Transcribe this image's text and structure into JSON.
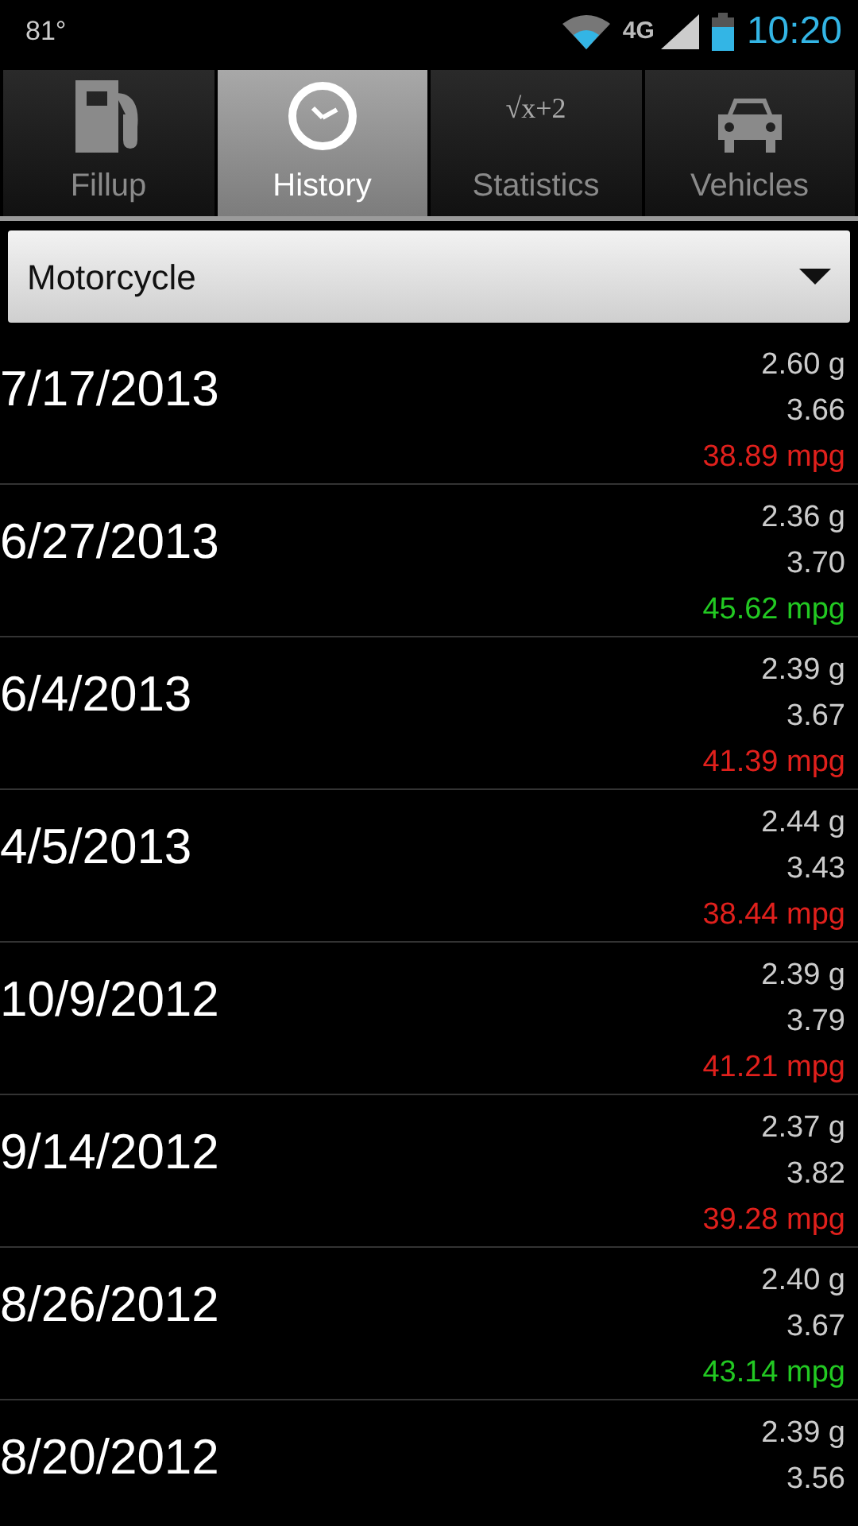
{
  "status_bar": {
    "temperature": "81°",
    "network": "4G",
    "time": "10:20"
  },
  "tabs": [
    {
      "label": "Fillup",
      "kind": "fuel",
      "selected": false
    },
    {
      "label": "History",
      "kind": "clock",
      "selected": true
    },
    {
      "label": "Statistics",
      "kind": "formula",
      "icon_text": "√x+2",
      "selected": false
    },
    {
      "label": "Vehicles",
      "kind": "car",
      "selected": false
    }
  ],
  "vehicle_select": {
    "value": "Motorcycle"
  },
  "fillups": [
    {
      "date": "7/17/2013",
      "gallons": "2.60 g",
      "price": "3.66",
      "mpg": "38.89 mpg",
      "color": "#e0201c"
    },
    {
      "date": "6/27/2013",
      "gallons": "2.36 g",
      "price": "3.70",
      "mpg": "45.62 mpg",
      "color": "#22c922"
    },
    {
      "date": "6/4/2013",
      "gallons": "2.39 g",
      "price": "3.67",
      "mpg": "41.39 mpg",
      "color": "#e0201c"
    },
    {
      "date": "4/5/2013",
      "gallons": "2.44 g",
      "price": "3.43",
      "mpg": "38.44 mpg",
      "color": "#e0201c"
    },
    {
      "date": "10/9/2012",
      "gallons": "2.39 g",
      "price": "3.79",
      "mpg": "41.21 mpg",
      "color": "#e0201c"
    },
    {
      "date": "9/14/2012",
      "gallons": "2.37 g",
      "price": "3.82",
      "mpg": "39.28 mpg",
      "color": "#e0201c"
    },
    {
      "date": "8/26/2012",
      "gallons": "2.40 g",
      "price": "3.67",
      "mpg": "43.14 mpg",
      "color": "#22c922"
    },
    {
      "date": "8/20/2012",
      "gallons": "2.39 g",
      "price": "3.56"
    }
  ]
}
